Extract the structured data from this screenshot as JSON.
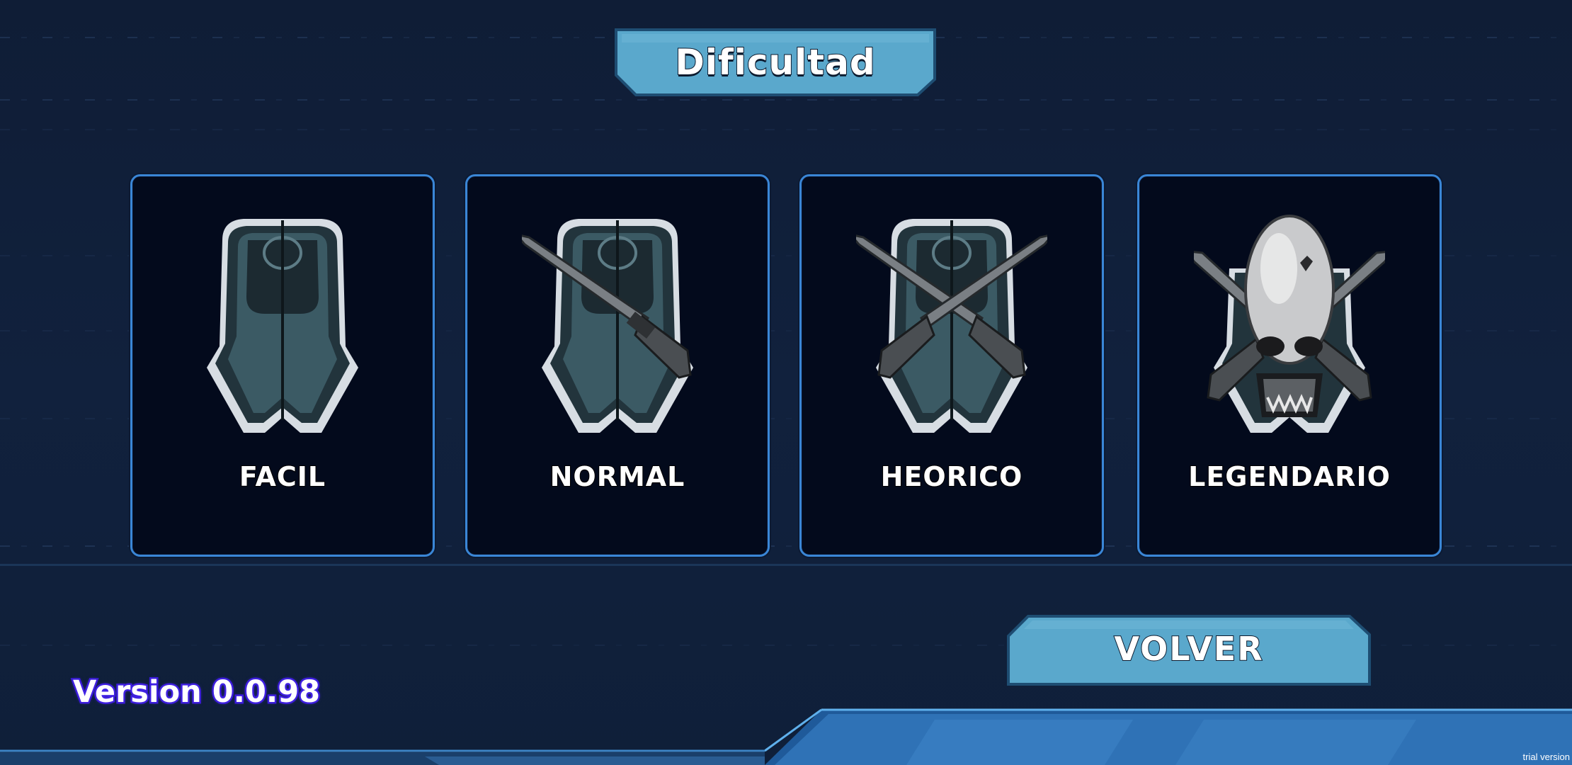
{
  "screen": {
    "title": "Dificultad",
    "difficulties": [
      {
        "label": "FACIL",
        "emblem": "helmet-icon"
      },
      {
        "label": "NORMAL",
        "emblem": "helmet-single-blade-icon"
      },
      {
        "label": "HEORICO",
        "emblem": "helmet-crossed-blades-icon"
      },
      {
        "label": "LEGENDARIO",
        "emblem": "skull-crossed-blades-icon"
      }
    ],
    "back_button": "VOLVER",
    "version": "Version 0.0.98",
    "watermark": "trial version"
  },
  "colors": {
    "background": "#11213d",
    "card_background": "#030a1c",
    "card_border": "#3a86d6",
    "banner": "#5aa8cc",
    "version_outline": "#3a1ad8"
  }
}
